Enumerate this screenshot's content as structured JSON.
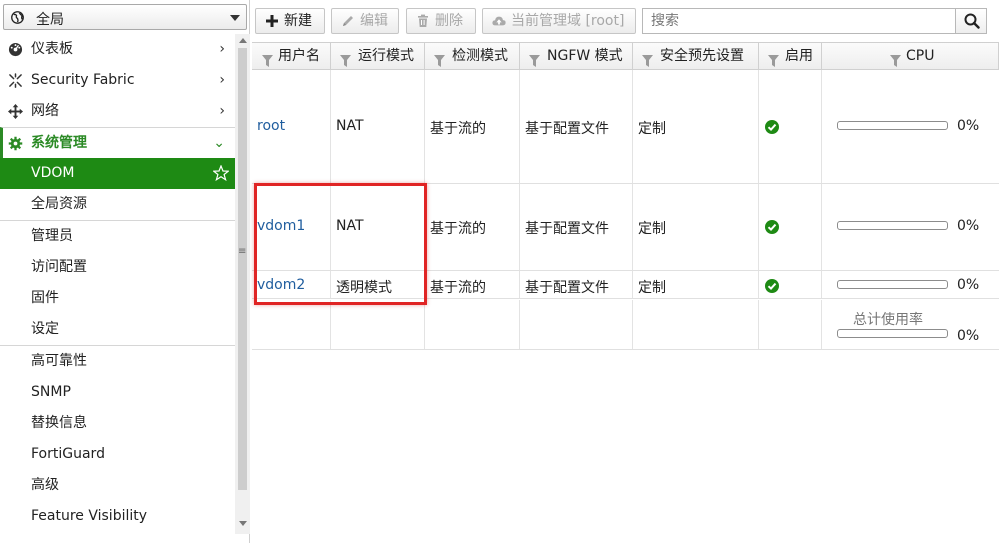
{
  "sidebar": {
    "scope": {
      "label": "全局"
    },
    "menu": [
      {
        "name": "dashboard",
        "label": "仪表板",
        "icon": "dashboard-icon",
        "chevron": "›"
      },
      {
        "name": "security-fabric",
        "label": "Security Fabric",
        "icon": "fabric-icon",
        "chevron": "›"
      },
      {
        "name": "network",
        "label": "网络",
        "icon": "network-icon",
        "chevron": "›"
      },
      {
        "name": "system",
        "label": "系统管理",
        "icon": "gear-icon",
        "chevron": "⌄"
      }
    ],
    "active_item": {
      "label": "VDOM"
    },
    "sub_a": [
      "全局资源"
    ],
    "sub_b": [
      "管理员",
      "访问配置",
      "固件",
      "设定"
    ],
    "sub_c": [
      "高可靠性",
      "SNMP",
      "替换信息",
      "FortiGuard",
      "高级",
      "Feature Visibility"
    ],
    "accent_color": "#1e8a14"
  },
  "toolbar": {
    "new_label": "新建",
    "edit_label": "编辑",
    "delete_label": "删除",
    "mgmt_label": "当前管理域 [root]",
    "search_placeholder": "搜索"
  },
  "table": {
    "columns": [
      "用户名",
      "运行模式",
      "检测模式",
      "NGFW 模式",
      "安全预先设置",
      "启用",
      "CPU"
    ],
    "rows": [
      {
        "name": "root",
        "op_mode": "NAT",
        "inspection": "基于流的",
        "ngfw": "基于配置文件",
        "preset": "定制",
        "enabled": true,
        "cpu": "0%",
        "cpu_value": 0
      },
      {
        "name": "vdom1",
        "op_mode": "NAT",
        "inspection": "基于流的",
        "ngfw": "基于配置文件",
        "preset": "定制",
        "enabled": true,
        "cpu": "0%",
        "cpu_value": 0
      },
      {
        "name": "vdom2",
        "op_mode": "透明模式",
        "inspection": "基于流的",
        "ngfw": "基于配置文件",
        "preset": "定制",
        "enabled": true,
        "cpu": "0%",
        "cpu_value": 0
      }
    ],
    "total": {
      "label": "总计使用率",
      "cpu": "0%",
      "cpu_value": 0
    }
  }
}
